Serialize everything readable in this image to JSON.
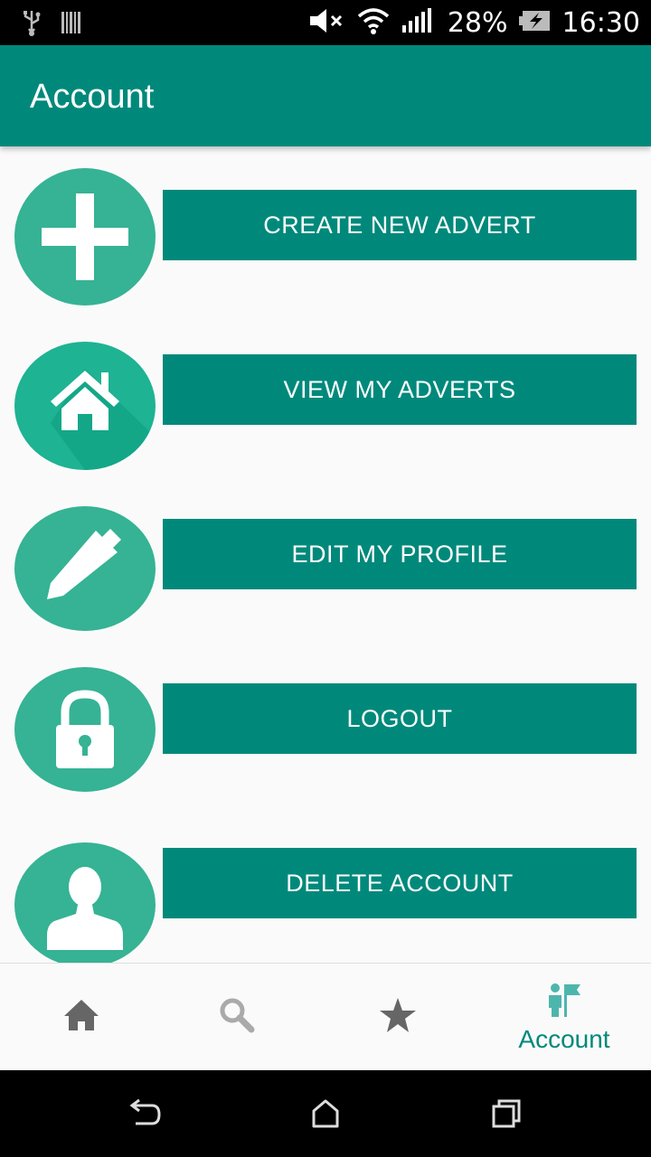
{
  "status_bar": {
    "battery": "28%",
    "time": "16:30",
    "icons": [
      "usb-icon",
      "barcode-icon",
      "mute-icon",
      "wifi-icon",
      "signal-icon",
      "battery-charging-icon"
    ]
  },
  "app_bar": {
    "title": "Account"
  },
  "menu": [
    {
      "label": "CREATE NEW ADVERT",
      "icon": "plus-icon"
    },
    {
      "label": "VIEW MY ADVERTS",
      "icon": "house-icon"
    },
    {
      "label": "EDIT MY PROFILE",
      "icon": "pencil-icon"
    },
    {
      "label": "LOGOUT",
      "icon": "lock-icon"
    },
    {
      "label": "DELETE ACCOUNT",
      "icon": "user-icon"
    }
  ],
  "bottom_nav": {
    "items": [
      {
        "icon": "home-icon",
        "label": ""
      },
      {
        "icon": "search-icon",
        "label": ""
      },
      {
        "icon": "star-icon",
        "label": ""
      },
      {
        "icon": "account-icon",
        "label": "Account",
        "active": true
      }
    ]
  },
  "system_nav": [
    "back-icon",
    "home-outline-icon",
    "recents-icon"
  ],
  "colors": {
    "primary": "#00897B",
    "circle": "#35B394",
    "status_bar": "#000000",
    "background": "#fafafa"
  }
}
